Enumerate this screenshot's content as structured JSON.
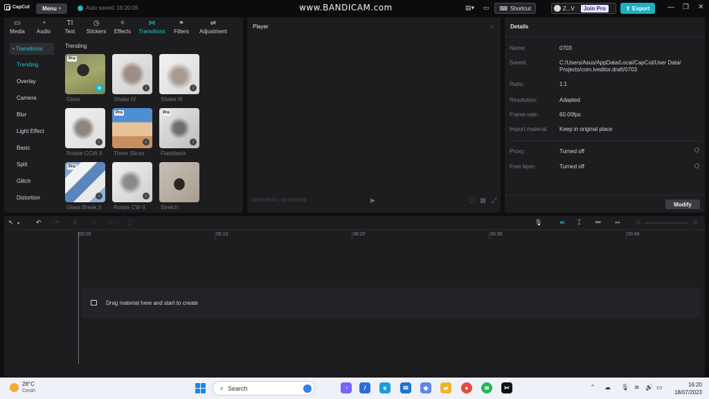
{
  "titlebar": {
    "app_name": "CapCut",
    "menu_label": "Menu",
    "autosave_text": "Auto saved: 16:20:05",
    "watermark": "www.BANDICAM.com",
    "shortcut_label": "Shortcut",
    "user_name": "Z...V",
    "join_pro_label": "Join Pro",
    "export_label": "Export"
  },
  "toolbar": {
    "tabs": [
      {
        "label": "Media",
        "icon": "media-icon",
        "glyph": "▭"
      },
      {
        "label": "Audio",
        "icon": "audio-icon",
        "glyph": "◔"
      },
      {
        "label": "Text",
        "icon": "text-icon",
        "glyph": "TI"
      },
      {
        "label": "Stickers",
        "icon": "stickers-icon",
        "glyph": "◷"
      },
      {
        "label": "Effects",
        "icon": "effects-icon",
        "glyph": "✧"
      },
      {
        "label": "Transitions",
        "icon": "transitions-icon",
        "glyph": "⋈"
      },
      {
        "label": "Filters",
        "icon": "filters-icon",
        "glyph": "⚭"
      },
      {
        "label": "Adjustment",
        "icon": "adjustment-icon",
        "glyph": "⇌"
      }
    ],
    "active_tab": "Transitions"
  },
  "sidebar": {
    "header": "• Transitions",
    "items": [
      "Trending",
      "Overlay",
      "Camera",
      "Blur",
      "Light Effect",
      "Basic",
      "Split",
      "Glitch",
      "Distortion"
    ],
    "active_item": "Trending"
  },
  "grid": {
    "title": "Trending",
    "tiles": [
      {
        "label": "Glare",
        "pro": true,
        "status": "add"
      },
      {
        "label": "Shake IV",
        "pro": false,
        "status": "download"
      },
      {
        "label": "Shake III",
        "pro": false,
        "status": "download"
      },
      {
        "label": "Rotate CCW II",
        "pro": false,
        "status": "download"
      },
      {
        "label": "Three Slices",
        "pro": true,
        "status": "download"
      },
      {
        "label": "Flashback",
        "pro": true,
        "status": "download"
      },
      {
        "label": "Glass Break II",
        "pro": true,
        "status": "download"
      },
      {
        "label": "Rotate CW II",
        "pro": false,
        "status": "download"
      },
      {
        "label": "Stretch",
        "pro": false,
        "status": "none"
      }
    ],
    "pro_badge": "Pro"
  },
  "player": {
    "title": "Player",
    "timecode": "00:00:00:00 | 00:00:00:00"
  },
  "details": {
    "title": "Details",
    "rows": [
      {
        "label": "Name:",
        "value": "0703"
      },
      {
        "label": "Saved:",
        "value": "C:/Users/Asus/AppData/Local/CapCut/User Data/\nProjects/com.lveditor.draft/0703"
      },
      {
        "label": "Ratio:",
        "value": "1:1"
      },
      {
        "label": "Resolution:",
        "value": "Adapted"
      },
      {
        "label": "Frame rate:",
        "value": "60.00fps"
      },
      {
        "label": "Import material",
        "value": "Keep in original place"
      },
      {
        "label": "Proxy:",
        "value": "Turned off"
      },
      {
        "label": "Free layer:",
        "value": "Turned off"
      }
    ],
    "modify_label": "Modify"
  },
  "timeline": {
    "ruler": [
      "00:00",
      "00:10",
      "00:20",
      "00:30",
      "00:40"
    ],
    "drop_text": "Drag material here and start to create"
  },
  "taskbar": {
    "temperature": "28°C",
    "weather": "Cerah",
    "search_placeholder": "Search",
    "time": "16:20",
    "date": "18/07/2023"
  },
  "colors": {
    "accent": "#29c0d0",
    "panel": "#1d1d20",
    "background": "#0f0f11",
    "export": "#1eaec3"
  }
}
